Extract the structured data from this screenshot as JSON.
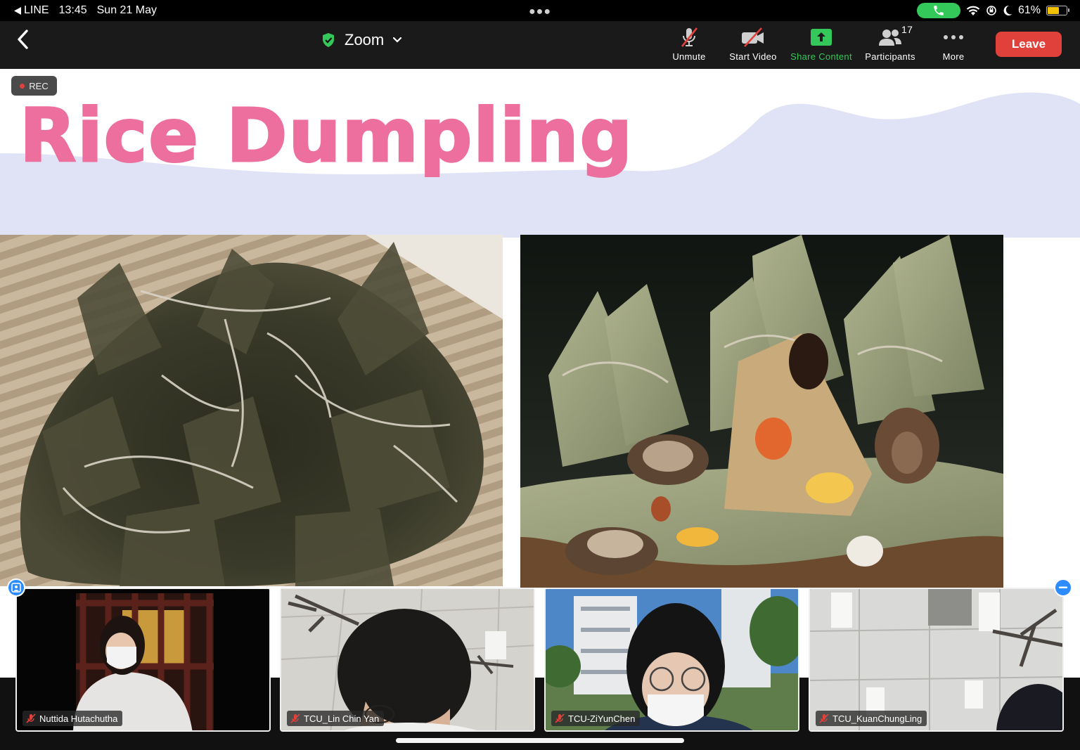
{
  "status_bar": {
    "back_app": "LINE",
    "time": "13:45",
    "date": "Sun 21 May",
    "battery": "61%",
    "battery_level": 0.61,
    "call_indicator_color": "#34c759"
  },
  "toolbar": {
    "title": "Zoom",
    "unmute_label": "Unmute",
    "start_video_label": "Start Video",
    "share_content_label": "Share Content",
    "participants_label": "Participants",
    "participants_count": "17",
    "more_label": "More",
    "leave_label": "Leave",
    "accent_green": "#34c759",
    "leave_color": "#e0413a"
  },
  "slide": {
    "rec_label": "REC",
    "title": "Rice Dumpling",
    "title_color": "#ed6f9d",
    "wave_color": "#dfe3f5",
    "photos": [
      "dumplings-bunch-photo",
      "dumpling-cut-open-photo"
    ]
  },
  "participants": [
    {
      "name": "Nuttida Hutachutha",
      "muted": true
    },
    {
      "name": "TCU_Lin Chin Yan",
      "muted": true
    },
    {
      "name": "TCU-ZiYunChen",
      "muted": true
    },
    {
      "name": "TCU_KuanChungLing",
      "muted": true
    }
  ]
}
